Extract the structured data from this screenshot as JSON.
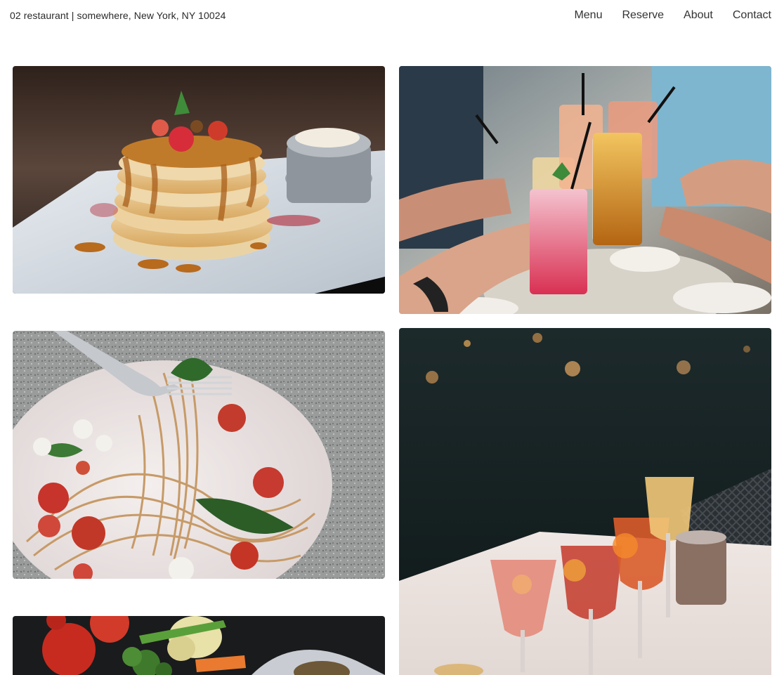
{
  "header": {
    "brand": "02 restaurant | somewhere, New York, NY 10024",
    "nav": [
      "Menu",
      "Reserve",
      "About",
      "Contact"
    ]
  },
  "gallery": {
    "photos": [
      {
        "subject": "pancakes-with-caramel-and-strawberries"
      },
      {
        "subject": "friends-toasting-cocktails"
      },
      {
        "subject": "spaghetti-with-tomatoes-and-spinach"
      },
      {
        "subject": "cocktail-glasses-on-table"
      },
      {
        "subject": "vegetables-on-dark-board"
      }
    ]
  }
}
